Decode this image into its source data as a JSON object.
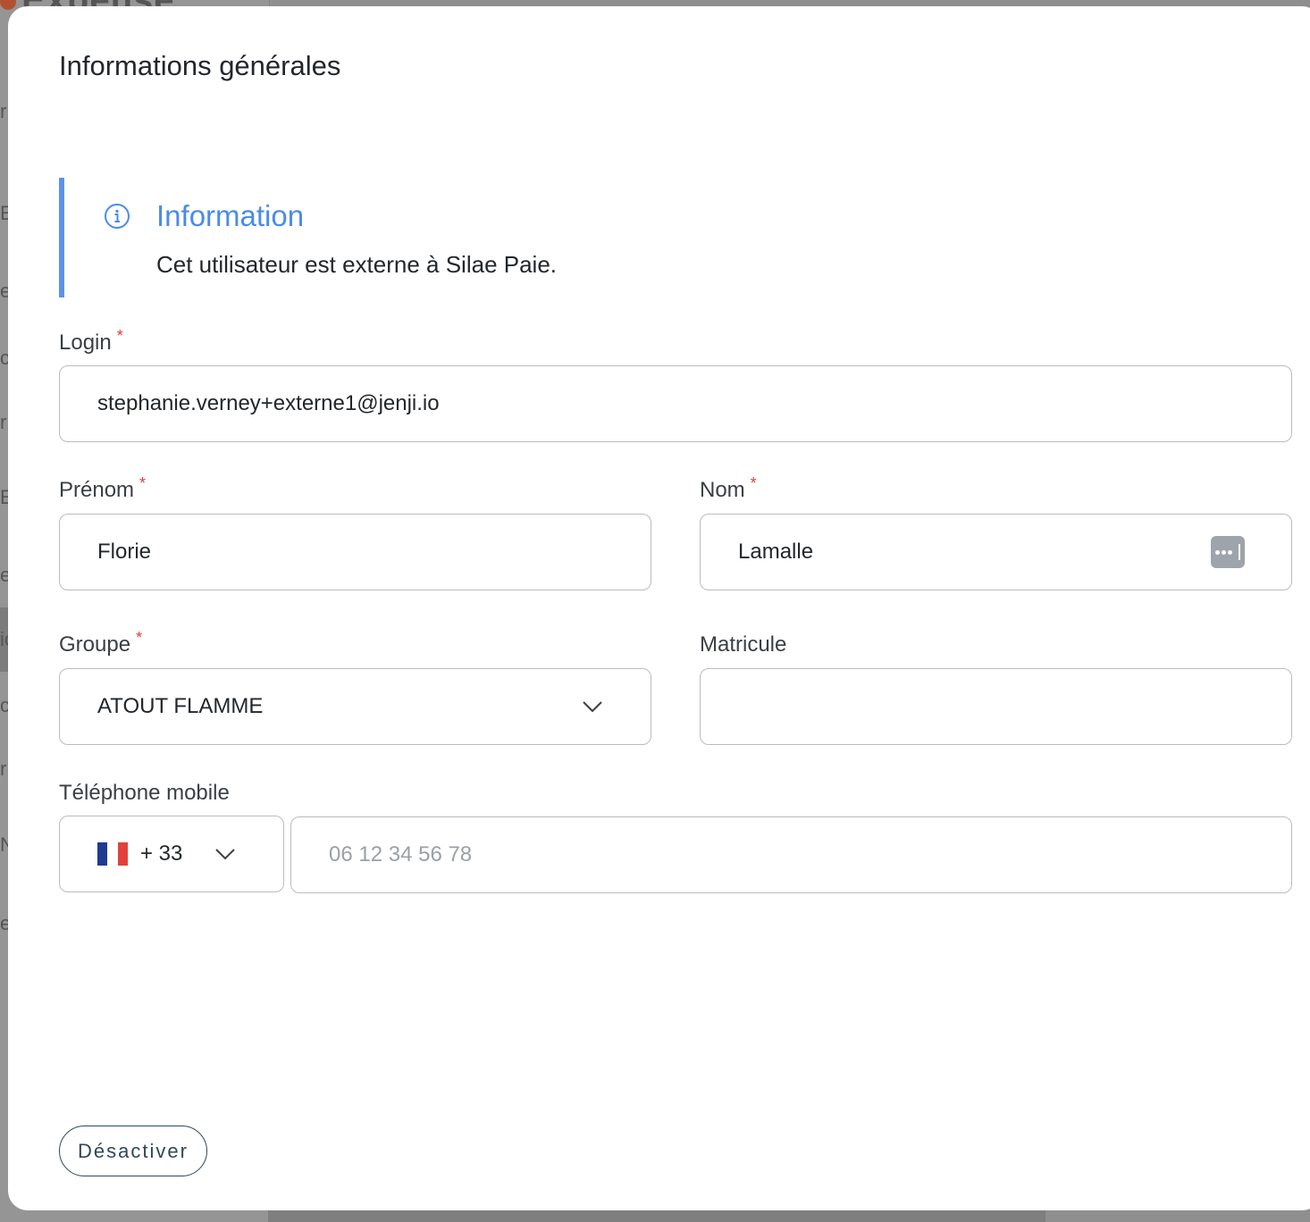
{
  "background": {
    "brand": "Expense",
    "sidebar_letters": [
      "r",
      "ES",
      "er",
      "cu",
      "r",
      "ES",
      "er",
      "ic",
      "co",
      "r",
      "N",
      "er"
    ]
  },
  "modal": {
    "title": "Informations générales",
    "info": {
      "icon": "info-circle-icon",
      "title": "Information",
      "text": "Cet utilisateur est externe à Silae Paie."
    },
    "login": {
      "label": "Login",
      "required_mark": "*",
      "value": "stephanie.verney+externe1@jenji.io"
    },
    "prenom": {
      "label": "Prénom",
      "required_mark": "*",
      "value": "Florie"
    },
    "nom": {
      "label": "Nom",
      "required_mark": "*",
      "value": "Lamalle",
      "autofill_icon": "password-manager-icon"
    },
    "groupe": {
      "label": "Groupe",
      "required_mark": "*",
      "value": "ATOUT FLAMME",
      "icon": "chevron-down-icon"
    },
    "matricule": {
      "label": "Matricule",
      "value": ""
    },
    "telephone": {
      "label": "Téléphone mobile",
      "country_flag": "france-flag-icon",
      "country_code": "+ 33",
      "placeholder": "06 12 34 56 78"
    },
    "deactivate_label": "Désactiver"
  },
  "colors": {
    "accent_blue": "#4a8ce6",
    "info_bar": "#5b93e8",
    "required_red": "#d9413a",
    "button_border": "#2f4858"
  }
}
